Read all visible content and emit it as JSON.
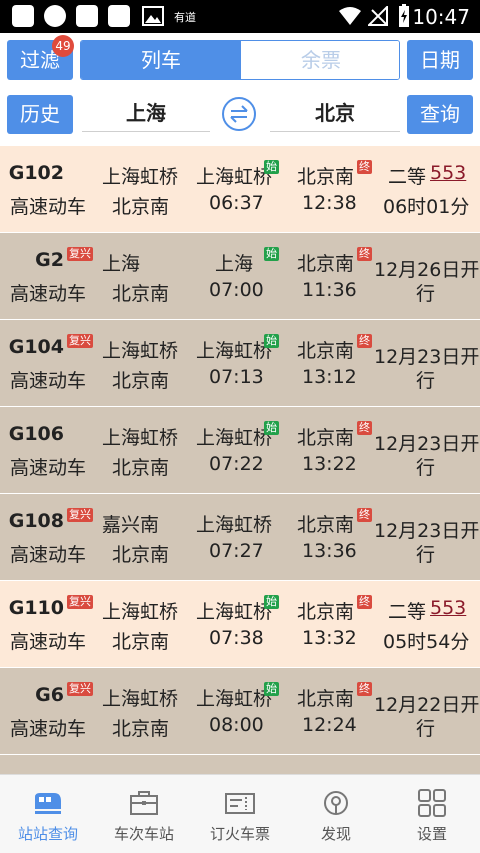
{
  "status_bar": {
    "app_text": "有道",
    "time": "10:47"
  },
  "top_bar": {
    "filter_label": "过滤",
    "filter_badge": "49",
    "tab_train": "列车",
    "tab_tickets": "余票",
    "date_label": "日期",
    "history_label": "历史",
    "from_station": "上海",
    "to_station": "北京",
    "query_label": "查询"
  },
  "trains": [
    {
      "no": "G102",
      "type": "高速动车",
      "fuxing": "",
      "from1": "上海虹桥",
      "from2": "北京南",
      "dep_station": "上海虹桥",
      "dep_tag": "始",
      "dep_time": "06:37",
      "arr_station": "北京南",
      "arr_tag": "终",
      "arr_time": "12:38",
      "info1": "二等",
      "price": "553",
      "info2": "06时01分",
      "style": "peach"
    },
    {
      "no": "G2",
      "type": "高速动车",
      "fuxing": "复兴",
      "from1": "上海",
      "from2": "北京南",
      "dep_station": "上海",
      "dep_tag": "始",
      "dep_time": "07:00",
      "arr_station": "北京南",
      "arr_tag": "终",
      "arr_time": "11:36",
      "info1": "12月26日开",
      "price": "",
      "info2": "行",
      "style": "tan"
    },
    {
      "no": "G104",
      "type": "高速动车",
      "fuxing": "复兴",
      "from1": "上海虹桥",
      "from2": "北京南",
      "dep_station": "上海虹桥",
      "dep_tag": "始",
      "dep_time": "07:13",
      "arr_station": "北京南",
      "arr_tag": "终",
      "arr_time": "13:12",
      "info1": "12月23日开",
      "price": "",
      "info2": "行",
      "style": "tan"
    },
    {
      "no": "G106",
      "type": "高速动车",
      "fuxing": "",
      "from1": "上海虹桥",
      "from2": "北京南",
      "dep_station": "上海虹桥",
      "dep_tag": "始",
      "dep_time": "07:22",
      "arr_station": "北京南",
      "arr_tag": "终",
      "arr_time": "13:22",
      "info1": "12月23日开",
      "price": "",
      "info2": "行",
      "style": "tan"
    },
    {
      "no": "G108",
      "type": "高速动车",
      "fuxing": "复兴",
      "from1": "嘉兴南",
      "from2": "北京南",
      "dep_station": "上海虹桥",
      "dep_tag": "",
      "dep_time": "07:27",
      "arr_station": "北京南",
      "arr_tag": "终",
      "arr_time": "13:36",
      "info1": "12月23日开",
      "price": "",
      "info2": "行",
      "style": "tan"
    },
    {
      "no": "G110",
      "type": "高速动车",
      "fuxing": "复兴",
      "from1": "上海虹桥",
      "from2": "北京南",
      "dep_station": "上海虹桥",
      "dep_tag": "始",
      "dep_time": "07:38",
      "arr_station": "北京南",
      "arr_tag": "终",
      "arr_time": "13:32",
      "info1": "二等",
      "price": "553",
      "info2": "05时54分",
      "style": "peach"
    },
    {
      "no": "G6",
      "type": "高速动车",
      "fuxing": "复兴",
      "from1": "上海虹桥",
      "from2": "北京南",
      "dep_station": "上海虹桥",
      "dep_tag": "始",
      "dep_time": "08:00",
      "arr_station": "北京南",
      "arr_tag": "终",
      "arr_time": "12:24",
      "info1": "12月22日开",
      "price": "",
      "info2": "行",
      "style": "tan"
    }
  ],
  "bottom_nav": [
    {
      "label": "站站查询",
      "icon": "train-icon",
      "active": true
    },
    {
      "label": "车次车站",
      "icon": "briefcase-icon",
      "active": false
    },
    {
      "label": "订火车票",
      "icon": "ticket-icon",
      "active": false
    },
    {
      "label": "发现",
      "icon": "compass-icon",
      "active": false
    },
    {
      "label": "设置",
      "icon": "grid-icon",
      "active": false
    }
  ],
  "colors": {
    "accent": "#4f8fe7",
    "row_available": "#fde9d8",
    "row_unavailable": "#d2c6b7",
    "tag_red": "#d94b3f",
    "tag_green": "#22a04a"
  }
}
